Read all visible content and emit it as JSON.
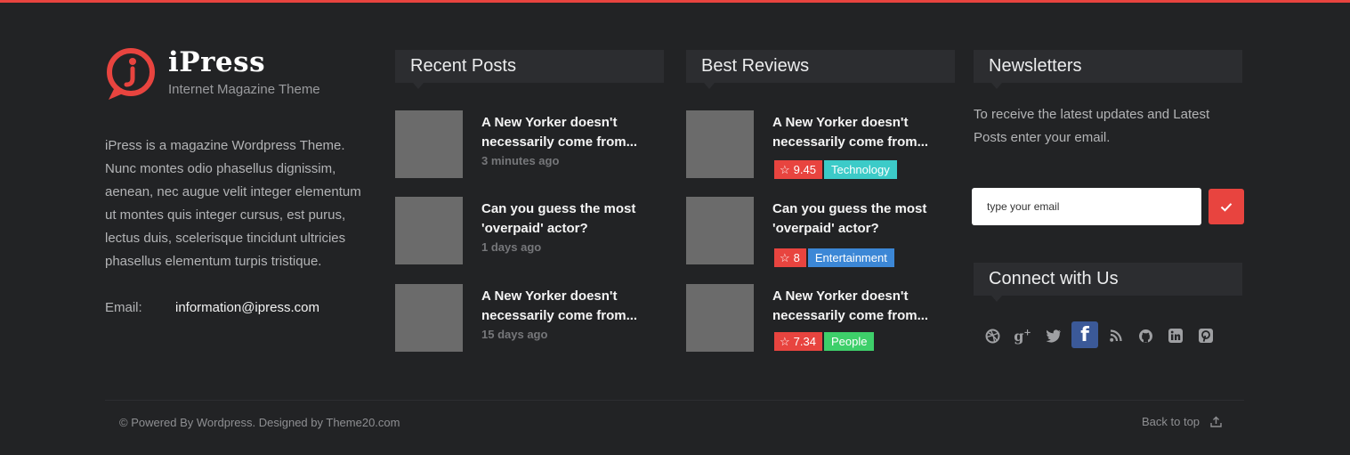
{
  "colors": {
    "accent": "#e8443f",
    "background": "#222325",
    "header_bg": "#2c2d30"
  },
  "brand": {
    "name": "iPress",
    "tagline": "Internet Magazine Theme",
    "description": "iPress is a  magazine Wordpress Theme. Nunc montes odio phasellus dignissim, aenean, nec augue velit integer elementum ut montes quis integer cursus, est purus, lectus duis, scelerisque tincidunt ultricies phasellus elementum turpis tristique.",
    "email_label": "Email:",
    "email": "information@ipress.com"
  },
  "recent_posts": {
    "title": "Recent Posts",
    "items": [
      {
        "title": "A New Yorker doesn't necessarily come from...",
        "time": "3 minutes ago"
      },
      {
        "title": "Can you guess the most 'overpaid' actor?",
        "time": "1 days ago"
      },
      {
        "title": "A New Yorker doesn't necessarily come from...",
        "time": "15 days ago"
      }
    ]
  },
  "best_reviews": {
    "title": "Best Reviews",
    "items": [
      {
        "title": "A New Yorker doesn't necessarily come from...",
        "rating": "9.45",
        "category": "Technology",
        "category_color": "#3ccbc8"
      },
      {
        "title": "Can you guess the most 'overpaid' actor?",
        "rating": "8",
        "category": "Entertainment",
        "category_color": "#3c87d6"
      },
      {
        "title": "A New Yorker doesn't necessarily come from...",
        "rating": "7.34",
        "category": "People",
        "category_color": "#3ecf6a"
      }
    ]
  },
  "newsletter": {
    "title": "Newsletters",
    "text": "To receive the latest updates and Latest Posts enter your email.",
    "placeholder": "type your email",
    "submit_icon": "check-icon"
  },
  "connect": {
    "title": "Connect with Us",
    "icons": [
      "dribbble-icon",
      "google-plus-icon",
      "twitter-icon",
      "facebook-icon",
      "rss-icon",
      "github-icon",
      "linkedin-icon",
      "pinterest-icon"
    ]
  },
  "footer": {
    "copyright": "© Powered By Wordpress.  Designed by Theme20.com",
    "back_to_top": "Back to top"
  }
}
